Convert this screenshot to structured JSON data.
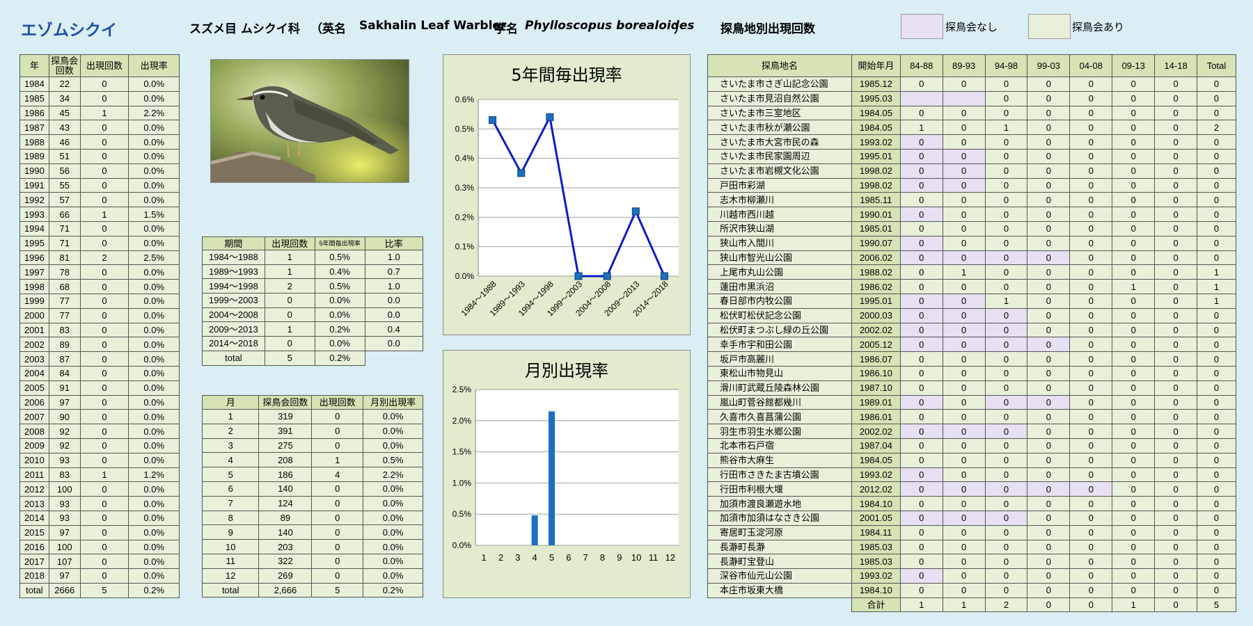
{
  "header": {
    "bird_name": "エゾムシクイ",
    "classification": "スズメ目 ムシクイ科",
    "english_open": "（英名",
    "english_name": "Sakhalin Leaf Warbler",
    "scientific_label": "学名",
    "scientific_name": "Phylloscopus borealoides",
    "scientific_close": "）",
    "site_table_title": "探鳥地別出現回数",
    "legend_none": "探鳥会なし",
    "legend_with": "探鳥会あり"
  },
  "colors": {
    "no_survey": "#e6e0f2",
    "with_survey": "#e9f0da",
    "header_fill": "#d5e3b5",
    "line": "#0a1fbe",
    "marker": "#1a6fc0",
    "bar": "#1a6fc0",
    "title_blue": "#1f4ea8"
  },
  "photo_icon": "warbler-photo",
  "year_table": {
    "headers": [
      "年",
      "探鳥会回数",
      "出現回数",
      "出現率"
    ],
    "rows": [
      [
        "1984",
        "22",
        "0",
        "0.0%"
      ],
      [
        "1985",
        "34",
        "0",
        "0.0%"
      ],
      [
        "1986",
        "45",
        "1",
        "2.2%"
      ],
      [
        "1987",
        "43",
        "0",
        "0.0%"
      ],
      [
        "1988",
        "46",
        "0",
        "0.0%"
      ],
      [
        "1989",
        "51",
        "0",
        "0.0%"
      ],
      [
        "1990",
        "56",
        "0",
        "0.0%"
      ],
      [
        "1991",
        "55",
        "0",
        "0.0%"
      ],
      [
        "1992",
        "57",
        "0",
        "0.0%"
      ],
      [
        "1993",
        "66",
        "1",
        "1.5%"
      ],
      [
        "1994",
        "71",
        "0",
        "0.0%"
      ],
      [
        "1995",
        "71",
        "0",
        "0.0%"
      ],
      [
        "1996",
        "81",
        "2",
        "2.5%"
      ],
      [
        "1997",
        "78",
        "0",
        "0.0%"
      ],
      [
        "1998",
        "68",
        "0",
        "0.0%"
      ],
      [
        "1999",
        "77",
        "0",
        "0.0%"
      ],
      [
        "2000",
        "77",
        "0",
        "0.0%"
      ],
      [
        "2001",
        "83",
        "0",
        "0.0%"
      ],
      [
        "2002",
        "89",
        "0",
        "0.0%"
      ],
      [
        "2003",
        "87",
        "0",
        "0.0%"
      ],
      [
        "2004",
        "84",
        "0",
        "0.0%"
      ],
      [
        "2005",
        "91",
        "0",
        "0.0%"
      ],
      [
        "2006",
        "97",
        "0",
        "0.0%"
      ],
      [
        "2007",
        "90",
        "0",
        "0.0%"
      ],
      [
        "2008",
        "92",
        "0",
        "0.0%"
      ],
      [
        "2009",
        "92",
        "0",
        "0.0%"
      ],
      [
        "2010",
        "93",
        "0",
        "0.0%"
      ],
      [
        "2011",
        "83",
        "1",
        "1.2%"
      ],
      [
        "2012",
        "100",
        "0",
        "0.0%"
      ],
      [
        "2013",
        "93",
        "0",
        "0.0%"
      ],
      [
        "2014",
        "93",
        "0",
        "0.0%"
      ],
      [
        "2015",
        "97",
        "0",
        "0.0%"
      ],
      [
        "2016",
        "100",
        "0",
        "0.0%"
      ],
      [
        "2017",
        "107",
        "0",
        "0.0%"
      ],
      [
        "2018",
        "97",
        "0",
        "0.0%"
      ]
    ],
    "total": [
      "total",
      "2666",
      "5",
      "0.2%"
    ]
  },
  "period_table": {
    "headers": [
      "期間",
      "出現回数",
      "5年間毎出現率",
      "比率"
    ],
    "rows": [
      [
        "1984～1988",
        "1",
        "0.5%",
        "1.0"
      ],
      [
        "1989～1993",
        "1",
        "0.4%",
        "0.7"
      ],
      [
        "1994～1998",
        "2",
        "0.5%",
        "1.0"
      ],
      [
        "1999～2003",
        "0",
        "0.0%",
        "0.0"
      ],
      [
        "2004～2008",
        "0",
        "0.0%",
        "0.0"
      ],
      [
        "2009～2013",
        "1",
        "0.2%",
        "0.4"
      ],
      [
        "2014～2018",
        "0",
        "0.0%",
        "0.0"
      ]
    ],
    "total": [
      "total",
      "5",
      "0.2%"
    ]
  },
  "month_table": {
    "headers": [
      "月",
      "探鳥会回数",
      "出現回数",
      "月別出現率"
    ],
    "rows": [
      [
        "1",
        "319",
        "0",
        "0.0%"
      ],
      [
        "2",
        "391",
        "0",
        "0.0%"
      ],
      [
        "3",
        "275",
        "0",
        "0.0%"
      ],
      [
        "4",
        "208",
        "1",
        "0.5%"
      ],
      [
        "5",
        "186",
        "4",
        "2.2%"
      ],
      [
        "6",
        "140",
        "0",
        "0.0%"
      ],
      [
        "7",
        "124",
        "0",
        "0.0%"
      ],
      [
        "8",
        "89",
        "0",
        "0.0%"
      ],
      [
        "9",
        "140",
        "0",
        "0.0%"
      ],
      [
        "10",
        "203",
        "0",
        "0.0%"
      ],
      [
        "11",
        "322",
        "0",
        "0.0%"
      ],
      [
        "12",
        "269",
        "0",
        "0.0%"
      ]
    ],
    "total": [
      "total",
      "2,666",
      "5",
      "0.2%"
    ]
  },
  "site_table": {
    "headers": [
      "探鳥地名",
      "開始年月",
      "84-88",
      "89-93",
      "94-98",
      "99-03",
      "04-08",
      "09-13",
      "14-18",
      "Total"
    ],
    "rows": [
      {
        "name": "さいたま市さぎ山記念公園",
        "start": "1985.12",
        "v": [
          "0",
          "0",
          "0",
          "0",
          "0",
          "0",
          "0",
          "0"
        ],
        "p": [
          0,
          0,
          0,
          0,
          0,
          0,
          0
        ]
      },
      {
        "name": "さいたま市見沼自然公園",
        "start": "1995.03",
        "v": [
          "",
          "",
          "0",
          "0",
          "0",
          "0",
          "0",
          "0"
        ],
        "p": [
          1,
          1,
          0,
          0,
          0,
          0,
          0
        ]
      },
      {
        "name": "さいたま市三室地区",
        "start": "1984.05",
        "v": [
          "0",
          "0",
          "0",
          "0",
          "0",
          "0",
          "0",
          "0"
        ],
        "p": [
          0,
          0,
          0,
          0,
          0,
          0,
          0
        ]
      },
      {
        "name": "さいたま市秋が瀬公園",
        "start": "1984.05",
        "v": [
          "1",
          "0",
          "1",
          "0",
          "0",
          "0",
          "0",
          "2"
        ],
        "p": [
          0,
          0,
          0,
          0,
          0,
          0,
          0
        ]
      },
      {
        "name": "さいたま市大宮市民の森",
        "start": "1993.02",
        "v": [
          "0",
          "0",
          "0",
          "0",
          "0",
          "0",
          "0",
          "0"
        ],
        "p": [
          1,
          0,
          0,
          0,
          0,
          0,
          0
        ]
      },
      {
        "name": "さいたま市民家園周辺",
        "start": "1995.01",
        "v": [
          "0",
          "0",
          "0",
          "0",
          "0",
          "0",
          "0",
          "0"
        ],
        "p": [
          1,
          1,
          0,
          0,
          0,
          0,
          0
        ]
      },
      {
        "name": "さいたま市岩槻文化公園",
        "start": "1998.02",
        "v": [
          "0",
          "0",
          "0",
          "0",
          "0",
          "0",
          "0",
          "0"
        ],
        "p": [
          1,
          1,
          0,
          0,
          0,
          0,
          0
        ]
      },
      {
        "name": "戸田市彩湖",
        "start": "1998.02",
        "v": [
          "0",
          "0",
          "0",
          "0",
          "0",
          "0",
          "0",
          "0"
        ],
        "p": [
          1,
          1,
          0,
          0,
          0,
          0,
          0
        ]
      },
      {
        "name": "志木市柳瀬川",
        "start": "1985.11",
        "v": [
          "0",
          "0",
          "0",
          "0",
          "0",
          "0",
          "0",
          "0"
        ],
        "p": [
          0,
          0,
          0,
          0,
          0,
          0,
          0
        ]
      },
      {
        "name": "川越市西川越",
        "start": "1990.01",
        "v": [
          "0",
          "0",
          "0",
          "0",
          "0",
          "0",
          "0",
          "0"
        ],
        "p": [
          1,
          0,
          0,
          0,
          0,
          0,
          0
        ]
      },
      {
        "name": "所沢市狭山湖",
        "start": "1985.01",
        "v": [
          "0",
          "0",
          "0",
          "0",
          "0",
          "0",
          "0",
          "0"
        ],
        "p": [
          0,
          0,
          0,
          0,
          0,
          0,
          0
        ]
      },
      {
        "name": "狭山市入間川",
        "start": "1990.07",
        "v": [
          "0",
          "0",
          "0",
          "0",
          "0",
          "0",
          "0",
          "0"
        ],
        "p": [
          1,
          0,
          0,
          0,
          0,
          0,
          0
        ]
      },
      {
        "name": "狭山市智光山公園",
        "start": "2006.02",
        "v": [
          "0",
          "0",
          "0",
          "0",
          "0",
          "0",
          "0",
          "0"
        ],
        "p": [
          1,
          1,
          1,
          1,
          0,
          0,
          0
        ]
      },
      {
        "name": "上尾市丸山公園",
        "start": "1988.02",
        "v": [
          "0",
          "1",
          "0",
          "0",
          "0",
          "0",
          "0",
          "1"
        ],
        "p": [
          0,
          0,
          0,
          0,
          0,
          0,
          0
        ]
      },
      {
        "name": "蓮田市黒浜沼",
        "start": "1986.02",
        "v": [
          "0",
          "0",
          "0",
          "0",
          "0",
          "1",
          "0",
          "1"
        ],
        "p": [
          0,
          0,
          0,
          0,
          0,
          0,
          0
        ]
      },
      {
        "name": "春日部市内牧公園",
        "start": "1995.01",
        "v": [
          "0",
          "0",
          "1",
          "0",
          "0",
          "0",
          "0",
          "1"
        ],
        "p": [
          1,
          1,
          0,
          0,
          0,
          0,
          0
        ]
      },
      {
        "name": "松伏町松伏記念公園",
        "start": "2000.03",
        "v": [
          "0",
          "0",
          "0",
          "0",
          "0",
          "0",
          "0",
          "0"
        ],
        "p": [
          1,
          1,
          1,
          0,
          0,
          0,
          0
        ]
      },
      {
        "name": "松伏町まつぶし緑の丘公園",
        "start": "2002.02",
        "v": [
          "0",
          "0",
          "0",
          "0",
          "0",
          "0",
          "0",
          "0"
        ],
        "p": [
          1,
          1,
          1,
          0,
          0,
          0,
          0
        ]
      },
      {
        "name": "幸手市宇和田公園",
        "start": "2005.12",
        "v": [
          "0",
          "0",
          "0",
          "0",
          "0",
          "0",
          "0",
          "0"
        ],
        "p": [
          1,
          1,
          1,
          1,
          0,
          0,
          0
        ]
      },
      {
        "name": "坂戸市高麗川",
        "start": "1986.07",
        "v": [
          "0",
          "0",
          "0",
          "0",
          "0",
          "0",
          "0",
          "0"
        ],
        "p": [
          0,
          0,
          0,
          0,
          0,
          0,
          0
        ]
      },
      {
        "name": "東松山市物見山",
        "start": "1986.10",
        "v": [
          "0",
          "0",
          "0",
          "0",
          "0",
          "0",
          "0",
          "0"
        ],
        "p": [
          0,
          0,
          0,
          0,
          0,
          0,
          0
        ]
      },
      {
        "name": "滑川町武蔵丘陵森林公園",
        "start": "1987.10",
        "v": [
          "0",
          "0",
          "0",
          "0",
          "0",
          "0",
          "0",
          "0"
        ],
        "p": [
          0,
          0,
          0,
          0,
          0,
          0,
          0
        ]
      },
      {
        "name": "嵐山町菅谷館都幾川",
        "start": "1989.01",
        "v": [
          "0",
          "0",
          "0",
          "0",
          "0",
          "0",
          "0",
          "0"
        ],
        "p": [
          1,
          0,
          1,
          1,
          0,
          0,
          0
        ]
      },
      {
        "name": "久喜市久喜菖蒲公園",
        "start": "1986.01",
        "v": [
          "0",
          "0",
          "0",
          "0",
          "0",
          "0",
          "0",
          "0"
        ],
        "p": [
          0,
          0,
          0,
          0,
          0,
          0,
          0
        ]
      },
      {
        "name": "羽生市羽生水郷公園",
        "start": "2002.02",
        "v": [
          "0",
          "0",
          "0",
          "0",
          "0",
          "0",
          "0",
          "0"
        ],
        "p": [
          1,
          1,
          1,
          0,
          0,
          0,
          0
        ]
      },
      {
        "name": "北本市石戸宿",
        "start": "1987.04",
        "v": [
          "0",
          "0",
          "0",
          "0",
          "0",
          "0",
          "0",
          "0"
        ],
        "p": [
          0,
          0,
          0,
          0,
          0,
          0,
          0
        ]
      },
      {
        "name": "熊谷市大麻生",
        "start": "1984.05",
        "v": [
          "0",
          "0",
          "0",
          "0",
          "0",
          "0",
          "0",
          "0"
        ],
        "p": [
          0,
          0,
          0,
          0,
          0,
          0,
          0
        ]
      },
      {
        "name": "行田市さきたま古墳公園",
        "start": "1993.02",
        "v": [
          "0",
          "0",
          "0",
          "0",
          "0",
          "0",
          "0",
          "0"
        ],
        "p": [
          1,
          0,
          0,
          0,
          0,
          0,
          0
        ]
      },
      {
        "name": "行田市利根大堰",
        "start": "2012.02",
        "v": [
          "0",
          "0",
          "0",
          "0",
          "0",
          "0",
          "0",
          "0"
        ],
        "p": [
          1,
          1,
          1,
          1,
          1,
          0,
          0
        ]
      },
      {
        "name": "加須市渡良瀬遊水地",
        "start": "1984.10",
        "v": [
          "0",
          "0",
          "0",
          "0",
          "0",
          "0",
          "0",
          "0"
        ],
        "p": [
          0,
          0,
          0,
          0,
          0,
          0,
          0
        ]
      },
      {
        "name": "加須市加須はなさき公園",
        "start": "2001.05",
        "v": [
          "0",
          "0",
          "0",
          "0",
          "0",
          "0",
          "0",
          "0"
        ],
        "p": [
          1,
          1,
          1,
          0,
          0,
          0,
          0
        ]
      },
      {
        "name": "寄居町玉淀河原",
        "start": "1984.11",
        "v": [
          "0",
          "0",
          "0",
          "0",
          "0",
          "0",
          "0",
          "0"
        ],
        "p": [
          0,
          0,
          0,
          0,
          0,
          0,
          0
        ]
      },
      {
        "name": "長瀞町長瀞",
        "start": "1985.03",
        "v": [
          "0",
          "0",
          "0",
          "0",
          "0",
          "0",
          "0",
          "0"
        ],
        "p": [
          0,
          0,
          0,
          0,
          0,
          0,
          0
        ]
      },
      {
        "name": "長瀞町宝登山",
        "start": "1985.03",
        "v": [
          "0",
          "0",
          "0",
          "0",
          "0",
          "0",
          "0",
          "0"
        ],
        "p": [
          0,
          0,
          0,
          0,
          0,
          0,
          0
        ]
      },
      {
        "name": "深谷市仙元山公園",
        "start": "1993.02",
        "v": [
          "0",
          "0",
          "0",
          "0",
          "0",
          "0",
          "0",
          "0"
        ],
        "p": [
          1,
          0,
          0,
          0,
          0,
          0,
          0
        ]
      },
      {
        "name": "本庄市坂東大橋",
        "start": "1984.10",
        "v": [
          "0",
          "0",
          "0",
          "0",
          "0",
          "0",
          "0",
          "0"
        ],
        "p": [
          0,
          0,
          0,
          0,
          0,
          0,
          0
        ]
      }
    ],
    "total_label": "合計",
    "total": [
      "1",
      "1",
      "2",
      "0",
      "0",
      "1",
      "0",
      "5"
    ]
  },
  "chart_data": [
    {
      "type": "line",
      "title": "5年間毎出現率",
      "categories": [
        "1984～1988",
        "1989～1993",
        "1994～1998",
        "1999～2003",
        "2004～2008",
        "2009～2013",
        "2014～2018"
      ],
      "values": [
        0.53,
        0.35,
        0.54,
        0.0,
        0.0,
        0.22,
        0.0
      ],
      "ylim": [
        0,
        0.6
      ],
      "yticks": [
        "0.0%",
        "0.1%",
        "0.2%",
        "0.3%",
        "0.4%",
        "0.5%",
        "0.6%"
      ],
      "grid": true
    },
    {
      "type": "bar",
      "title": "月別出現率",
      "categories": [
        "1",
        "2",
        "3",
        "4",
        "5",
        "6",
        "7",
        "8",
        "9",
        "10",
        "11",
        "12"
      ],
      "values": [
        0,
        0,
        0,
        0.48,
        2.15,
        0,
        0,
        0,
        0,
        0,
        0,
        0
      ],
      "ylim": [
        0,
        2.5
      ],
      "yticks": [
        "0.0%",
        "0.5%",
        "1.0%",
        "1.5%",
        "2.0%",
        "2.5%"
      ],
      "grid": true
    }
  ]
}
